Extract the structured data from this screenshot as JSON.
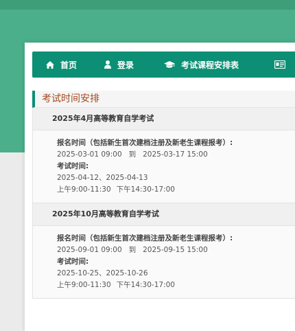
{
  "nav": {
    "home_label": "首页",
    "login_label": "登录",
    "schedule_label": "考试课程安排表",
    "home_icon": "home-icon",
    "login_icon": "user-icon",
    "schedule_icon": "graduation-cap-icon",
    "extra_icon": "id-card-icon"
  },
  "section": {
    "title": "考试时间安排"
  },
  "exams": [
    {
      "title": "2025年4月高等教育自学考试",
      "register_label": "报名时间（包括新生首次建档注册及新老生课程报考）:",
      "register_start": "2025-03-01 09:00",
      "to_label": "到",
      "register_end": "2025-03-17 15:00",
      "exam_label": "考试时间:",
      "exam_dates": "2025-04-12、2025-04-13",
      "morning": "上午9:00-11:30",
      "afternoon": "下午14:30-17:00"
    },
    {
      "title": "2025年10月高等教育自学考试",
      "register_label": "报名时间（包括新生首次建档注册及新老生课程报考）:",
      "register_start": "2025-09-01 09:00",
      "to_label": "到",
      "register_end": "2025-09-15 15:00",
      "exam_label": "考试时间:",
      "exam_dates": "2025-10-25、2025-10-26",
      "morning": "上午9:00-11:30",
      "afternoon": "下午14:30-17:00"
    }
  ],
  "colors": {
    "header_band": "#4aaf8a",
    "nav_bg": "#0c8f74",
    "section_title": "#a64a1f"
  }
}
